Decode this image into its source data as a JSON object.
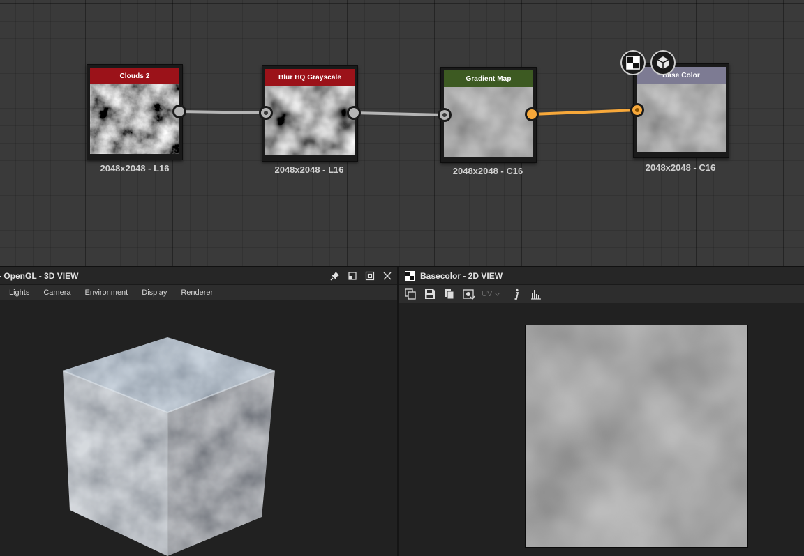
{
  "graph": {
    "nodes": [
      {
        "id": "clouds2",
        "title": "Clouds 2",
        "caption": "2048x2048 - L16",
        "header_color": "#9b1219"
      },
      {
        "id": "blur",
        "title": "Blur HQ Grayscale",
        "caption": "2048x2048 - L16",
        "header_color": "#9b1219"
      },
      {
        "id": "gradient",
        "title": "Gradient Map",
        "caption": "2048x2048 - C16",
        "header_color": "#3d5a22"
      },
      {
        "id": "basecolor",
        "title": "Base Color",
        "caption": "2048x2048 - C16",
        "header_color": "#7d7b93"
      }
    ],
    "connections": [
      {
        "from": "clouds2",
        "to": "blur",
        "color": "#b5b5b5"
      },
      {
        "from": "blur",
        "to": "gradient",
        "color": "#b5b5b5"
      },
      {
        "from": "gradient",
        "to": "basecolor",
        "color": "#f7a83a"
      }
    ],
    "output_badges": [
      "checker-icon",
      "cube-icon"
    ]
  },
  "view3d": {
    "title": "- OpenGL - 3D VIEW",
    "menu": [
      "Lights",
      "Camera",
      "Environment",
      "Display",
      "Renderer"
    ],
    "title_icons": [
      "pin-icon",
      "restore-icon",
      "maximize-icon",
      "close-icon"
    ]
  },
  "view2d": {
    "title": "Basecolor - 2D VIEW",
    "uv_label": "UV",
    "toolbar_icons": [
      "copy-view-icon",
      "save-icon",
      "copy-icon",
      "export-icon",
      "uv-icon",
      "info-icon",
      "histogram-icon"
    ]
  },
  "colors": {
    "accent_orange": "#f7a83a",
    "graph_bg": "#3a3a3a",
    "panel_bg": "#212121"
  }
}
